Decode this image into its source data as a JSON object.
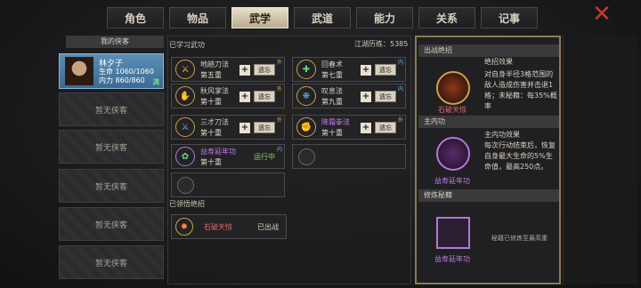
{
  "tabs": [
    "角色",
    "物品",
    "武学",
    "武道",
    "能力",
    "关系",
    "记事"
  ],
  "active_tab": 2,
  "roster": {
    "title": "我的侠客",
    "hero": {
      "name": "林夕子",
      "hp": "生命 1060/1060",
      "mp": "内力 860/860",
      "status": "满"
    },
    "empty_label": "暂无侠客"
  },
  "learned": {
    "title": "已学习武功",
    "exp": "江湖历练：5385",
    "skills": [
      {
        "name": "地趟刀法",
        "level": "第五重",
        "action": "遗忘",
        "tag": "外"
      },
      {
        "name": "回春术",
        "level": "第七重",
        "action": "遗忘",
        "tag": "内"
      },
      {
        "name": "秋风掌法",
        "level": "第十重",
        "action": "遗忘",
        "tag": "外"
      },
      {
        "name": "叹息法",
        "level": "第九重",
        "action": "遗忘",
        "tag": "内"
      },
      {
        "name": "三才刀法",
        "level": "第十重",
        "action": "遗忘",
        "tag": "外"
      },
      {
        "name": "降霜拳法",
        "level": "第十重",
        "action": "遗忘",
        "tag": "外"
      },
      {
        "name": "益寿延年功",
        "level": "第十重",
        "action": "运行中",
        "tag": "内"
      }
    ]
  },
  "ultimate": {
    "title": "已领悟绝招",
    "name": "石破天惊",
    "status": "已出战"
  },
  "detail": {
    "ult_title": "出战绝招",
    "ult_name": "石破天惊",
    "ult_effect_title": "绝招效果",
    "ult_effect": "对自身半径3格范围的敌人造成伤害并击退1格；未秘籍：每35%概率",
    "inner_title": "主内功",
    "inner_name": "益寿延年功",
    "inner_effect_title": "主内功效果",
    "inner_effect": "每次行动结束后，恢复自身最大生命的5%生命值，最高250点。",
    "book_title": "修炼秘籍",
    "book_name": "益寿延年功",
    "book_note": "秘籍已修炼至最高重"
  },
  "colors": {
    "accent": "#c9a050",
    "active_tab": "#e8dfc8",
    "running": "#7fd46a",
    "ult_name": "#e06a6a"
  }
}
